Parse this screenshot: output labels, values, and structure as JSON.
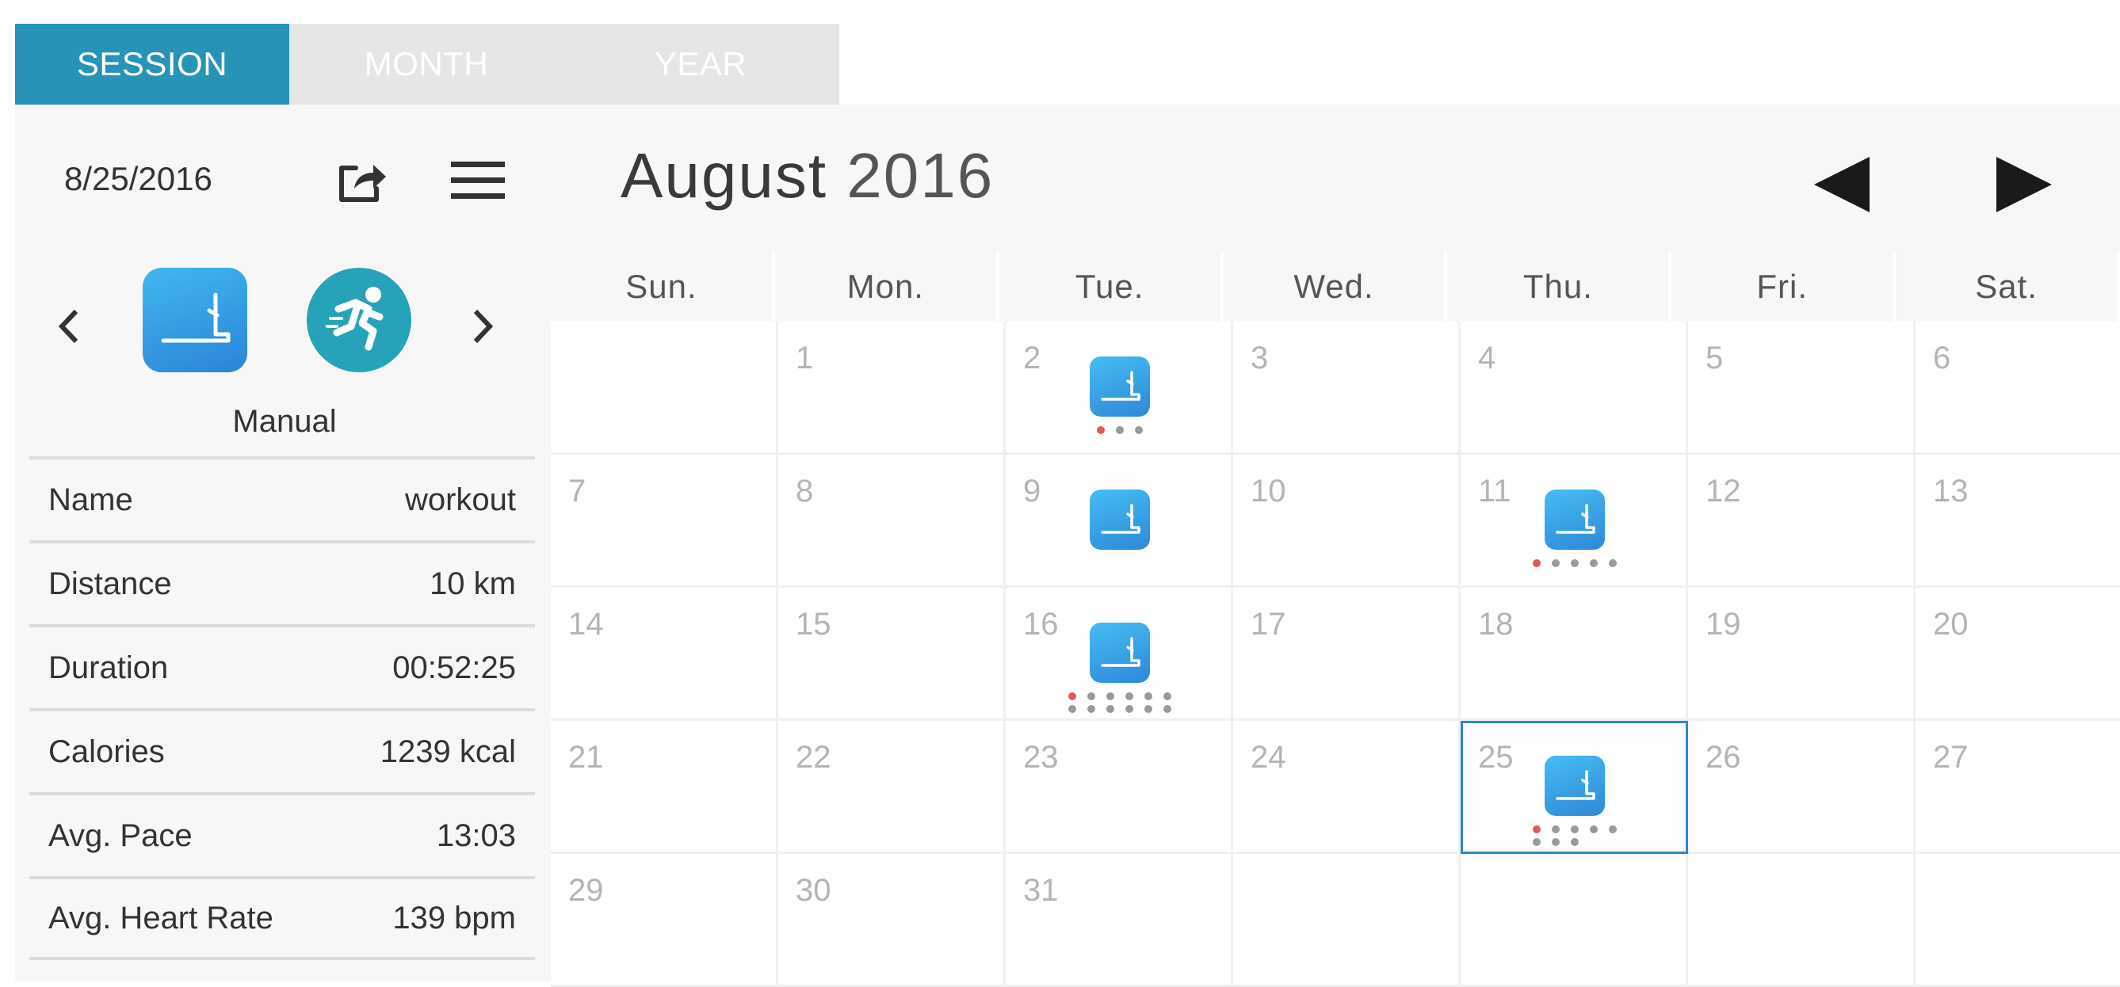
{
  "tabs": [
    {
      "label": "SESSION",
      "active": true
    },
    {
      "label": "MONTH",
      "active": false
    },
    {
      "label": "YEAR",
      "active": false
    }
  ],
  "sidebar": {
    "date": "8/25/2016",
    "mode_label": "Manual",
    "stats": [
      {
        "label": "Name",
        "value": "workout"
      },
      {
        "label": "Distance",
        "value": "10 km"
      },
      {
        "label": "Duration",
        "value": "00:52:25"
      },
      {
        "label": "Calories",
        "value": "1239 kcal"
      },
      {
        "label": "Avg. Pace",
        "value": "13:03"
      },
      {
        "label": "Avg. Heart Rate",
        "value": "139 bpm"
      }
    ]
  },
  "calendar": {
    "month": "August",
    "year": "2016",
    "weekdays": [
      "Sun.",
      "Mon.",
      "Tue.",
      "Wed.",
      "Thu.",
      "Fri.",
      "Sat."
    ],
    "days": [
      "",
      "1",
      "2",
      "3",
      "4",
      "5",
      "6",
      "7",
      "8",
      "9",
      "10",
      "11",
      "12",
      "13",
      "14",
      "15",
      "16",
      "17",
      "18",
      "19",
      "20",
      "21",
      "22",
      "23",
      "24",
      "25",
      "26",
      "27",
      "29",
      "30",
      "31",
      "",
      "",
      "",
      ""
    ],
    "selected_day": "25",
    "sessions": [
      {
        "day": "2",
        "dots": 3
      },
      {
        "day": "9",
        "dots": 0
      },
      {
        "day": "11",
        "dots": 5
      },
      {
        "day": "16",
        "dots": 12
      },
      {
        "day": "25",
        "dots": 8
      }
    ]
  },
  "colors": {
    "accent": "#2793b7",
    "tab_inactive": "#e6e6e6",
    "selected_border": "#2a8cc4",
    "day_number": "#b5b5b5",
    "dot_active": "#e05a5a",
    "dot_inactive": "#9a9a9a"
  },
  "icons": {
    "share": "share-icon",
    "menu": "menu-icon",
    "prev_mode": "chevron-left-icon",
    "next_mode": "chevron-right-icon",
    "treadmill": "treadmill-icon",
    "runner": "runner-icon",
    "prev_month": "triangle-left-icon",
    "next_month": "triangle-right-icon"
  }
}
